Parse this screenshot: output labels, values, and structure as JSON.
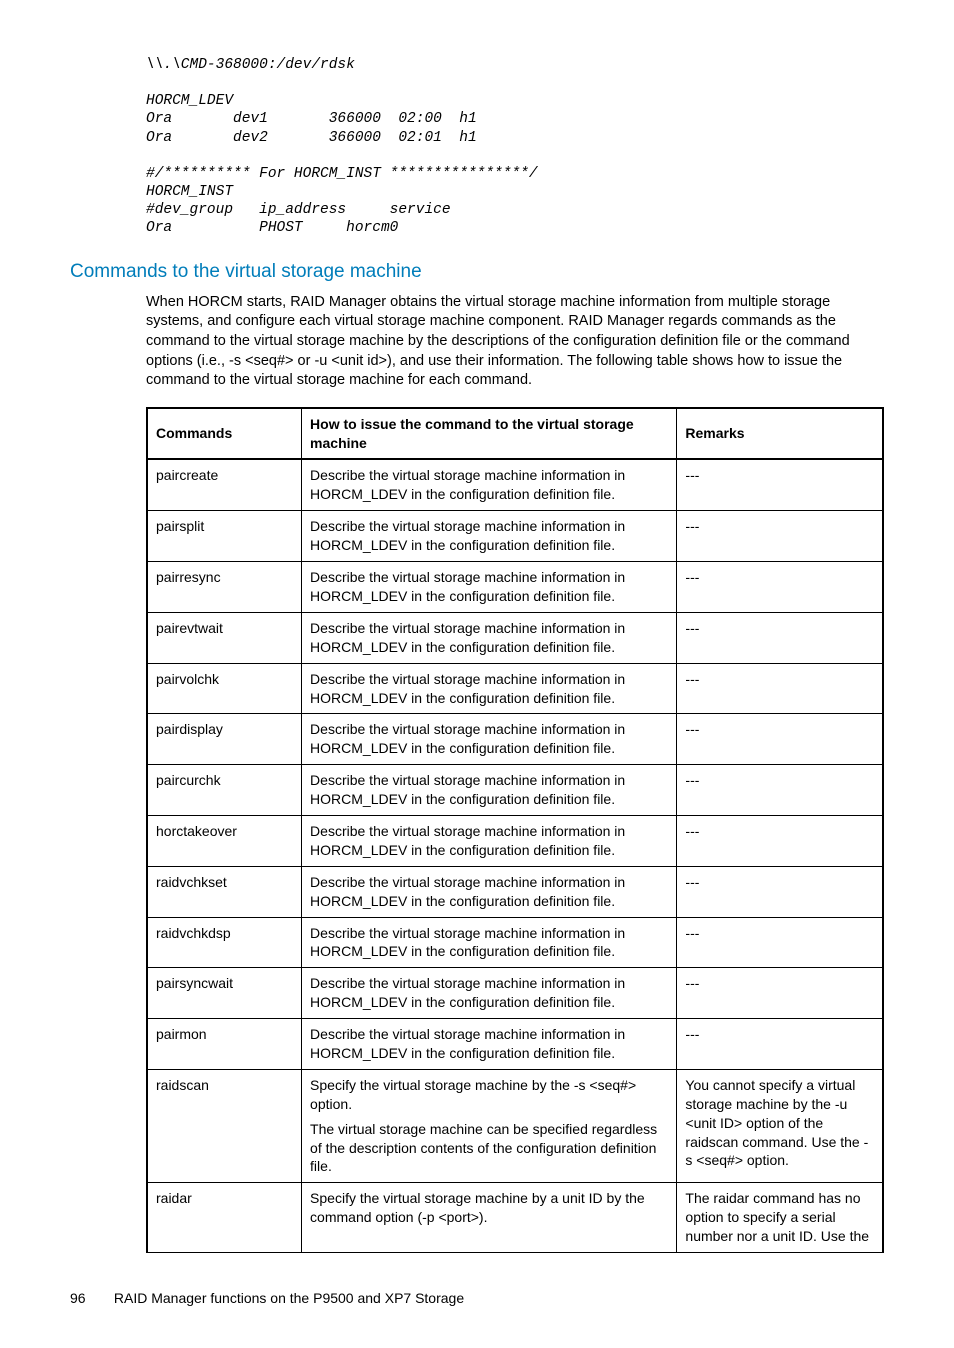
{
  "code": "\\\\.\\CMD-368000:/dev/rdsk\n\nHORCM_LDEV\nOra       dev1       366000  02:00  h1\nOra       dev2       366000  02:01  h1\n\n#/********** For HORCM_INST ****************/\nHORCM_INST\n#dev_group   ip_address     service\nOra          PHOST     horcm0",
  "section_title": "Commands to the virtual storage machine",
  "paragraph": "When HORCM starts, RAID Manager obtains the virtual storage machine information from multiple storage systems, and configure each virtual storage machine component. RAID Manager regards commands as the command to the virtual storage machine by the descriptions of the configuration definition file or the command options (i.e., -s <seq#> or -u <unit id>), and use their information. The following table shows how to issue the command to the virtual storage machine for each command.",
  "table": {
    "headers": {
      "c1": "Commands",
      "c2": "How to issue the command to the virtual storage machine",
      "c3": "Remarks"
    },
    "std_desc": "Describe the virtual storage machine information in HORCM_LDEV in the configuration definition file.",
    "dash": "---",
    "rows_std": [
      "paircreate",
      "pairsplit",
      "pairresync",
      "pairevtwait",
      "pairvolchk",
      "pairdisplay",
      "paircurchk",
      "horctakeover",
      "raidvchkset",
      "raidvchkdsp",
      "pairsyncwait",
      "pairmon"
    ],
    "raidscan": {
      "cmd": "raidscan",
      "how1": "Specify the virtual storage machine by the -s <seq#> option.",
      "how2": "The virtual storage machine can be specified regardless of the description contents of the configuration definition file.",
      "rem": "You cannot specify a virtual storage machine by the -u <unit ID> option of the raidscan command. Use the -s <seq#> option."
    },
    "raidar": {
      "cmd": "raidar",
      "how": "Specify the virtual storage machine by a unit ID by the command option (-p <port>).",
      "rem": "The raidar command has no option to specify a serial number nor a unit ID. Use the"
    }
  },
  "footer": {
    "page": "96",
    "title": "RAID Manager functions on the P9500 and XP7 Storage"
  }
}
